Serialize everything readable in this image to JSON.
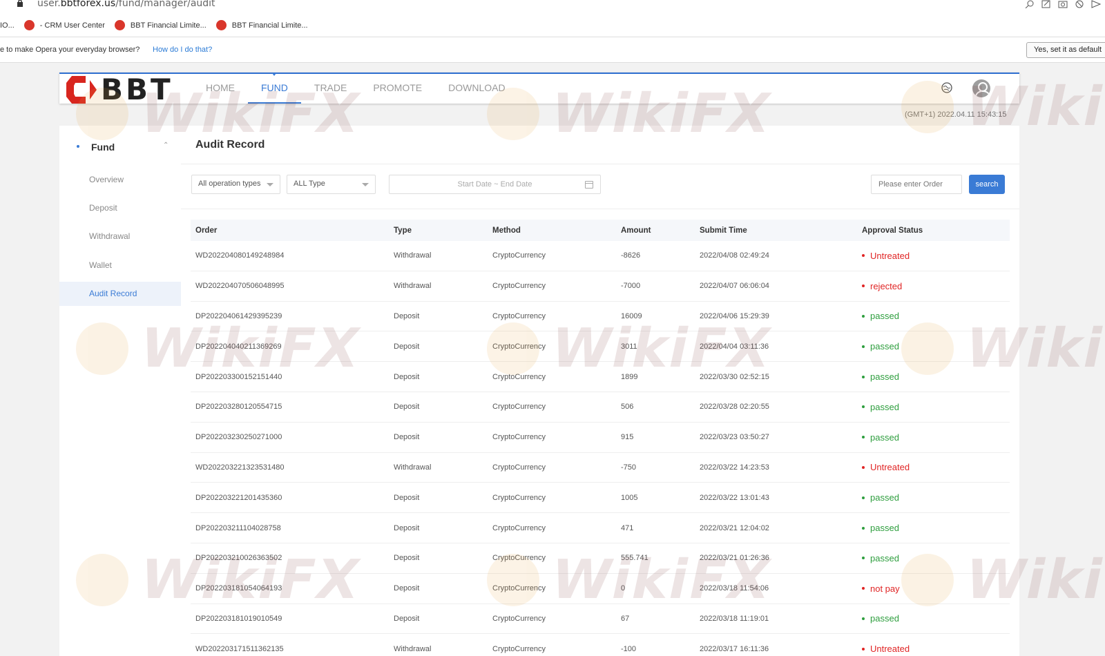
{
  "browser": {
    "url_prefix": "user.",
    "url_domain": "bbtforex.us",
    "url_path": "/fund/manager/audit",
    "bookmarks": [
      {
        "label": "IO...",
        "color": "#999999"
      },
      {
        "label": "- CRM User Center",
        "color": "#d9362b"
      },
      {
        "label": "BBT Financial Limite...",
        "color": "#d9362b"
      },
      {
        "label": "BBT Financial Limite...",
        "color": "#d9362b"
      }
    ],
    "default_prompt": "e to make Opera your everyday browser?",
    "default_link": "How do I do that?",
    "default_button": "Yes, set it as default"
  },
  "header": {
    "logo_text": "BBT",
    "nav": [
      "HOME",
      "FUND",
      "TRADE",
      "PROMOTE",
      "DOWNLOAD"
    ],
    "active_nav": "FUND",
    "timezone": "(GMT+1) 2022.04.11 15:43:15"
  },
  "sidebar": {
    "section": "Fund",
    "items": [
      "Overview",
      "Deposit",
      "Withdrawal",
      "Wallet",
      "Audit Record"
    ],
    "active": "Audit Record"
  },
  "main": {
    "title": "Audit Record",
    "filters": {
      "operation_type": "All operation types",
      "type": "ALL Type",
      "date_placeholder": "Start Date ~ End Date",
      "order_placeholder": "Please enter Order",
      "search_label": "search"
    },
    "columns": [
      "Order",
      "Type",
      "Method",
      "Amount",
      "Submit Time",
      "Approval Status"
    ],
    "rows": [
      {
        "order": "WD202204080149248984",
        "type": "Withdrawal",
        "method": "CryptoCurrency",
        "amount": "-8626",
        "time": "2022/04/08 02:49:24",
        "status": "Untreated"
      },
      {
        "order": "WD202204070506048995",
        "type": "Withdrawal",
        "method": "CryptoCurrency",
        "amount": "-7000",
        "time": "2022/04/07 06:06:04",
        "status": "rejected"
      },
      {
        "order": "DP202204061429395239",
        "type": "Deposit",
        "method": "CryptoCurrency",
        "amount": "16009",
        "time": "2022/04/06 15:29:39",
        "status": "passed"
      },
      {
        "order": "DP202204040211369269",
        "type": "Deposit",
        "method": "CryptoCurrency",
        "amount": "3011",
        "time": "2022/04/04 03:11:36",
        "status": "passed"
      },
      {
        "order": "DP202203300152151440",
        "type": "Deposit",
        "method": "CryptoCurrency",
        "amount": "1899",
        "time": "2022/03/30 02:52:15",
        "status": "passed"
      },
      {
        "order": "DP202203280120554715",
        "type": "Deposit",
        "method": "CryptoCurrency",
        "amount": "506",
        "time": "2022/03/28 02:20:55",
        "status": "passed"
      },
      {
        "order": "DP202203230250271000",
        "type": "Deposit",
        "method": "CryptoCurrency",
        "amount": "915",
        "time": "2022/03/23 03:50:27",
        "status": "passed"
      },
      {
        "order": "WD202203221323531480",
        "type": "Withdrawal",
        "method": "CryptoCurrency",
        "amount": "-750",
        "time": "2022/03/22 14:23:53",
        "status": "Untreated"
      },
      {
        "order": "DP202203221201435360",
        "type": "Deposit",
        "method": "CryptoCurrency",
        "amount": "1005",
        "time": "2022/03/22 13:01:43",
        "status": "passed"
      },
      {
        "order": "DP202203211104028758",
        "type": "Deposit",
        "method": "CryptoCurrency",
        "amount": "471",
        "time": "2022/03/21 12:04:02",
        "status": "passed"
      },
      {
        "order": "DP202203210026363502",
        "type": "Deposit",
        "method": "CryptoCurrency",
        "amount": "555.741",
        "time": "2022/03/21 01:26:36",
        "status": "passed"
      },
      {
        "order": "DP202203181054064193",
        "type": "Deposit",
        "method": "CryptoCurrency",
        "amount": "0",
        "time": "2022/03/18 11:54:06",
        "status": "not pay"
      },
      {
        "order": "DP202203181019010549",
        "type": "Deposit",
        "method": "CryptoCurrency",
        "amount": "67",
        "time": "2022/03/18 11:19:01",
        "status": "passed"
      },
      {
        "order": "WD202203171511362135",
        "type": "Withdrawal",
        "method": "CryptoCurrency",
        "amount": "-100",
        "time": "2022/03/17 16:11:36",
        "status": "Untreated"
      }
    ]
  },
  "status_colors": {
    "Untreated": "#e02424",
    "rejected": "#e02424",
    "not pay": "#e02424",
    "passed": "#2e9e3e"
  },
  "colors": {
    "accent": "#3a7bd5",
    "logo_red": "#d8261f"
  },
  "watermark_text": "WikiFX"
}
